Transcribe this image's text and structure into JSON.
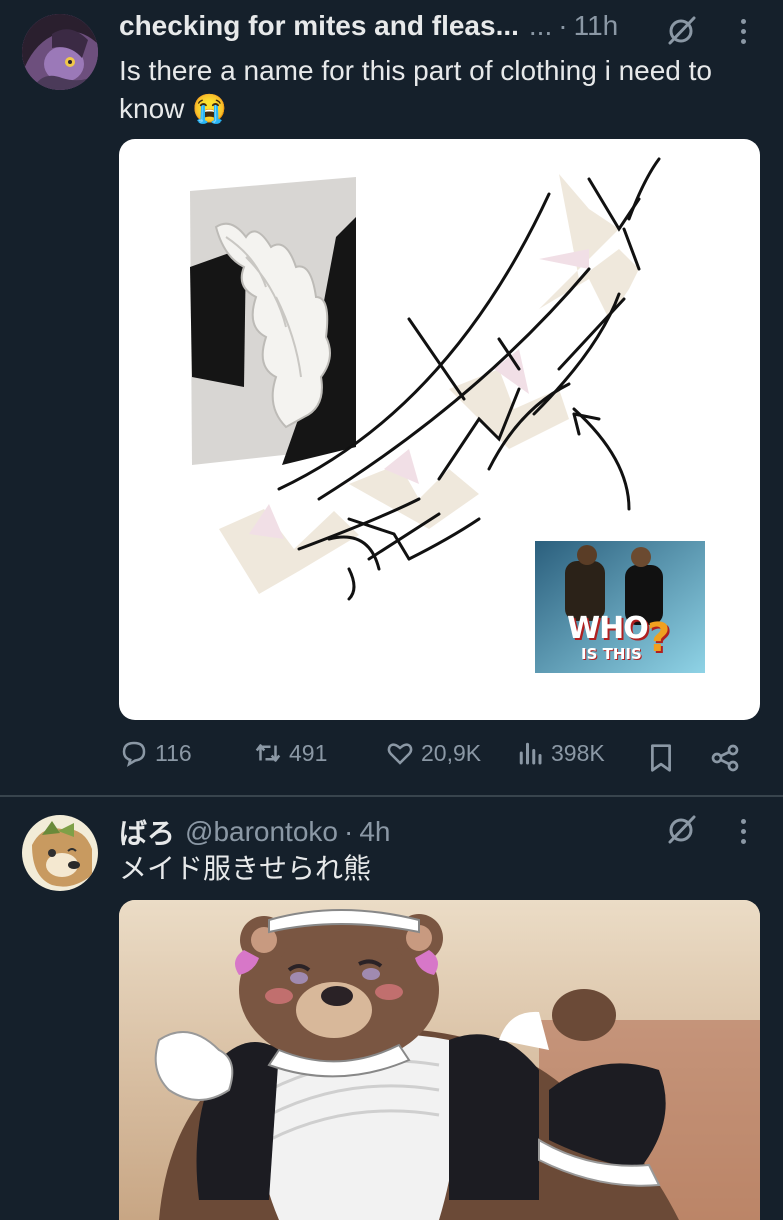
{
  "posts": [
    {
      "display_name": "checking for mites and fleas...",
      "handle": "...",
      "time": "11h",
      "text": "Is there a name for this part of clothing i need to know",
      "emoji": "😭",
      "media_thumb_caption_line1": "WHO",
      "media_thumb_caption_line2": "IS THIS",
      "media_thumb_caption_mark": "?",
      "stats": {
        "replies": "116",
        "reposts": "491",
        "likes": "20,9K",
        "views": "398K"
      }
    },
    {
      "display_name": "ばろ",
      "handle": "@barontoko",
      "time": "4h",
      "text": "メイド服きせられ熊"
    }
  ],
  "separator": "·",
  "colors": {
    "background": "#15202b",
    "text_primary": "#e7e9ea",
    "text_muted": "#8b98a5",
    "divider": "#38444d"
  },
  "icons": [
    "grok-icon",
    "more-icon",
    "reply-icon",
    "repost-icon",
    "like-icon",
    "views-icon",
    "bookmark-icon",
    "share-icon"
  ]
}
